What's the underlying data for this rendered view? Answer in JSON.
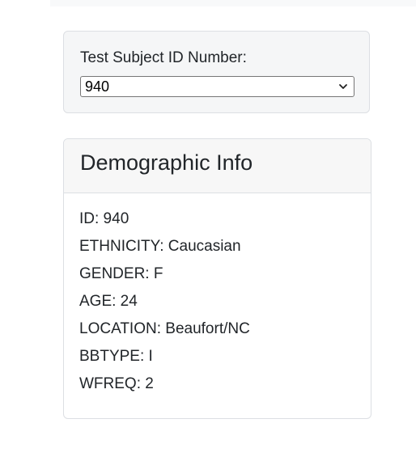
{
  "selector": {
    "label": "Test Subject ID Number:",
    "selected_value": "940"
  },
  "demographics": {
    "title": "Demographic Info",
    "lines": [
      "ID: 940",
      "ETHNICITY: Caucasian",
      "GENDER: F",
      "AGE: 24",
      "LOCATION: Beaufort/NC",
      "BBTYPE: I",
      "WFREQ: 2"
    ]
  },
  "icons": {
    "select_arrow": "chevron-down-icon"
  }
}
